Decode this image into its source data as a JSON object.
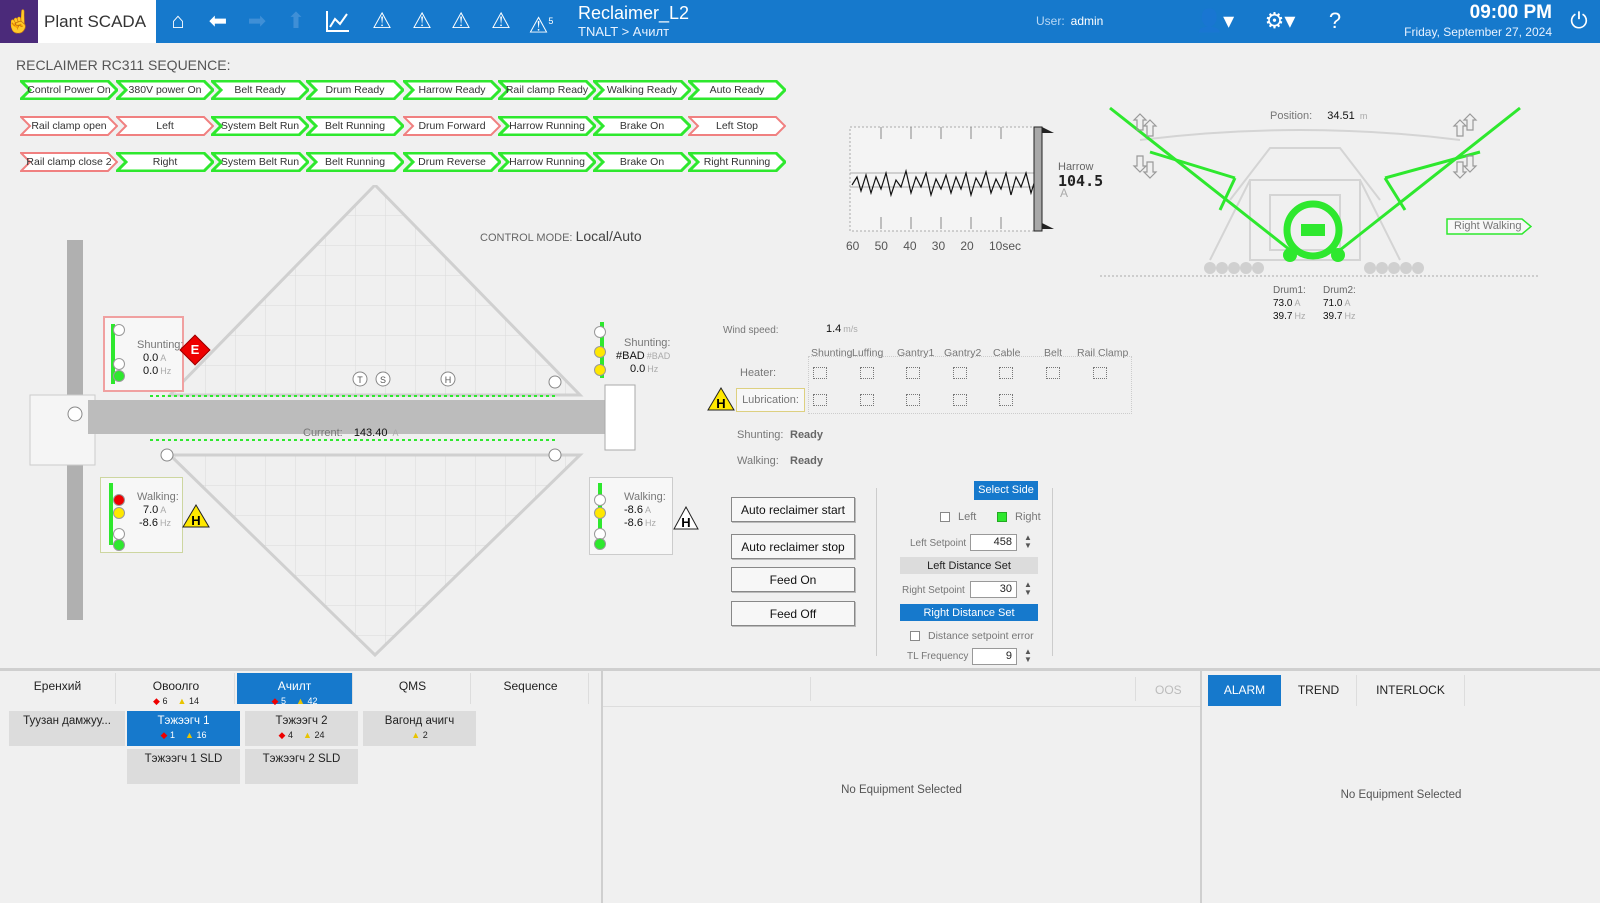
{
  "header": {
    "logo": "Plant SCADA",
    "title": "Reclaimer_L2",
    "path": "TNALT > Ачилт",
    "user_label": "User:",
    "user_name": "admin",
    "time": "09:00 PM",
    "date": "Friday, September 27, 2024",
    "alarm_count_badge": "5"
  },
  "sequence": {
    "title": "RECLAIMER RC311 SEQUENCE:",
    "rows": [
      [
        "Control Power On",
        "380V power On",
        "Belt Ready",
        "Drum Ready",
        "Harrow Ready",
        "Rail clamp Ready",
        "Walking Ready",
        "Auto Ready"
      ],
      [
        "Rail clamp open",
        "Left",
        "System Belt Run",
        "Belt Running",
        "Drum Forward",
        "Harrow Running",
        "Brake On",
        "Left Stop"
      ],
      [
        "Rail clamp close 2",
        "Right",
        "System Belt Run",
        "Belt Running",
        "Drum Reverse",
        "Harrow Running",
        "Brake On",
        "Right Running"
      ]
    ],
    "states": [
      [
        "on",
        "on",
        "on",
        "on",
        "on",
        "on",
        "on",
        "on"
      ],
      [
        "off",
        "off",
        "on",
        "on",
        "off",
        "on",
        "on",
        "off"
      ],
      [
        "off",
        "on",
        "on",
        "on",
        "on",
        "on",
        "on",
        "on"
      ]
    ]
  },
  "control_mode": {
    "label": "CONTROL MODE:",
    "value": "Local/Auto"
  },
  "machine": {
    "shunting_left": {
      "label": "Shunting:",
      "v1": "0.0",
      "u1": "A",
      "v2": "0.0",
      "u2": "Hz",
      "badge": "E"
    },
    "shunting_right": {
      "label": "Shunting:",
      "v1": "#BAD",
      "u1": "#BAD",
      "v2": "0.0",
      "u2": "Hz"
    },
    "walking_left": {
      "label": "Walking:",
      "v1": "7.0",
      "u1": "A",
      "v2": "-8.6",
      "u2": "Hz",
      "badge": "H"
    },
    "walking_right": {
      "label": "Walking:",
      "v1": "-8.6",
      "u1": "A",
      "v2": "-8.6",
      "u2": "Hz",
      "badge": "H"
    },
    "current": {
      "label": "Current:",
      "value": "143.40",
      "unit": "A"
    },
    "markers": [
      "T",
      "S",
      "H"
    ]
  },
  "trend": {
    "label": "Harrow",
    "value": "104.5",
    "unit": "A",
    "ticks": [
      "60",
      "50",
      "40",
      "30",
      "20",
      "10sec"
    ]
  },
  "side_view": {
    "position_label": "Position:",
    "position_value": "34.51",
    "position_unit": "m",
    "right_walking": "Right Walking",
    "drum1": {
      "label": "Drum1:",
      "a": "73.0",
      "hz": "39.7"
    },
    "drum2": {
      "label": "Drum2:",
      "a": "71.0",
      "hz": "39.7"
    },
    "unit_a": "A",
    "unit_hz": "Hz"
  },
  "status": {
    "wind_label": "Wind speed:",
    "wind_value": "1.4",
    "wind_unit": "m/s",
    "columns": [
      "Shunting",
      "Luffing",
      "Gantry1",
      "Gantry2",
      "Cable",
      "Belt",
      "Rail Clamp"
    ],
    "heater_label": "Heater:",
    "lubrication_label": "Lubrication:",
    "lubrication_badge": "H",
    "shunting_label": "Shunting:",
    "shunting_value": "Ready",
    "walking_label": "Walking:",
    "walking_value": "Ready"
  },
  "buttons": {
    "auto_start": "Auto reclaimer start",
    "auto_stop": "Auto reclaimer stop",
    "feed_on": "Feed On",
    "feed_off": "Feed Off"
  },
  "setpoints": {
    "select_side": "Select Side",
    "left": "Left",
    "right": "Right",
    "side_selected": "Right",
    "left_setpoint_label": "Left Setpoint",
    "left_setpoint_value": "458",
    "left_distance_set": "Left Distance Set",
    "right_setpoint_label": "Right Setpoint",
    "right_setpoint_value": "30",
    "right_distance_set": "Right Distance Set",
    "distance_error": "Distance setpoint error",
    "tl_frequency_label": "TL Frequency",
    "tl_frequency_value": "9"
  },
  "bottom": {
    "tabs": [
      {
        "label": "Еренхий",
        "red": "",
        "yellow": ""
      },
      {
        "label": "Овоолго",
        "red": "6",
        "yellow": "14"
      },
      {
        "label": "Ачилт",
        "red": "5",
        "yellow": "42"
      },
      {
        "label": "QMS",
        "red": "",
        "yellow": ""
      },
      {
        "label": "Sequence",
        "red": "",
        "yellow": ""
      }
    ],
    "subs": [
      {
        "label": "Туузан дамжуу...",
        "red": "",
        "yellow": ""
      },
      {
        "label": "Тэжээгч 1",
        "red": "1",
        "yellow": "16"
      },
      {
        "label": "Тэжээгч 2",
        "red": "4",
        "yellow": "24"
      },
      {
        "label": "Вагонд ачигч",
        "red": "",
        "yellow": "2"
      },
      {
        "label": "Тэжээгч 1 SLD",
        "red": "",
        "yellow": ""
      },
      {
        "label": "Тэжээгч 2 SLD",
        "red": "",
        "yellow": ""
      }
    ],
    "middle_oos": "OOS",
    "middle_empty": "No Equipment Selected",
    "right_tabs": [
      "ALARM",
      "TREND",
      "INTERLOCK"
    ],
    "right_empty": "No Equipment Selected"
  },
  "colors": {
    "header": "#1679cc",
    "green": "#2ee82e",
    "red_outline": "#f08080",
    "accent": "#1679cc"
  }
}
